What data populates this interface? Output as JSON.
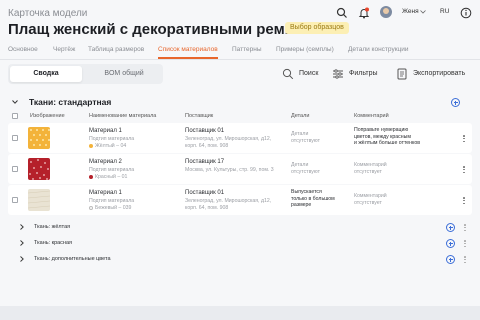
{
  "header": {
    "breadcrumb": "Карточка модели",
    "title": "Плащ женский с декоративными ремнями",
    "badge": "Выбор образцов",
    "user_name": "Женя",
    "language": "RU"
  },
  "tabs": [
    "Основное",
    "Чертёж",
    "Таблица размеров",
    "Список материалов",
    "Паттерны",
    "Примеры (семплы)",
    "Детали конструкции"
  ],
  "active_tab_index": 3,
  "subtabs": {
    "summary": "Сводка",
    "bom": "BOM общий"
  },
  "toolbar": {
    "search": "Поиск",
    "filters": "Фильтры",
    "export": "Экспортировать"
  },
  "section": {
    "title": "Ткани: стандартная"
  },
  "table": {
    "columns": {
      "image": "Изображение",
      "name": "Наименование материала",
      "supplier": "Поставщик",
      "details": "Детали",
      "comment": "Комментарий"
    },
    "rows": [
      {
        "name": "Материал 1",
        "subtype": "Подтип материала",
        "color": "Жёлтый – 04",
        "supplier": "Поставщик 01",
        "address_1": "Зеленоград, ул. Мирошорская, д12,",
        "address_2": "корп. 64, пом. 908",
        "details_1": "Детали",
        "details_2": "отсутствуют",
        "comment_1": "Поправьте нумерацию",
        "comment_2": "цветов, между красным",
        "comment_3": "и жёлтым больше оттенков"
      },
      {
        "name": "Материал 2",
        "subtype": "Подтип материала",
        "color": "Красный – 01",
        "supplier": "Поставщик 17",
        "address_1": "Москва, ул. Культуры, стр. 99, пом. 3",
        "address_2": "",
        "details_1": "Детали",
        "details_2": "отсутствуют",
        "comment_1": "Комментарий",
        "comment_2": "отсутствует",
        "comment_3": ""
      },
      {
        "name": "Материал 1",
        "subtype": "Подтип материала",
        "color": "Бежевый – 039",
        "supplier": "Поставщик 01",
        "address_1": "Зеленоград, ул. Мирошорская, д12,",
        "address_2": "корп. 64, пом. 908",
        "details_1": "Выпускается",
        "details_2": "только в большом",
        "details_3": "размере",
        "comment_1": "Комментарий",
        "comment_2": "отсутствует",
        "comment_3": ""
      }
    ]
  },
  "groups": [
    "Ткань: жёлтая",
    "Ткань: красная",
    "Ткань: дополнительные цвета"
  ],
  "colors": {
    "accent": "#e8662c",
    "link": "#3d6fd8",
    "badge_bg": "#fcefb4",
    "yellow_swatch": "#f3b33a",
    "red_swatch": "#b5202a",
    "beige_swatch": "#e9e3d3"
  }
}
